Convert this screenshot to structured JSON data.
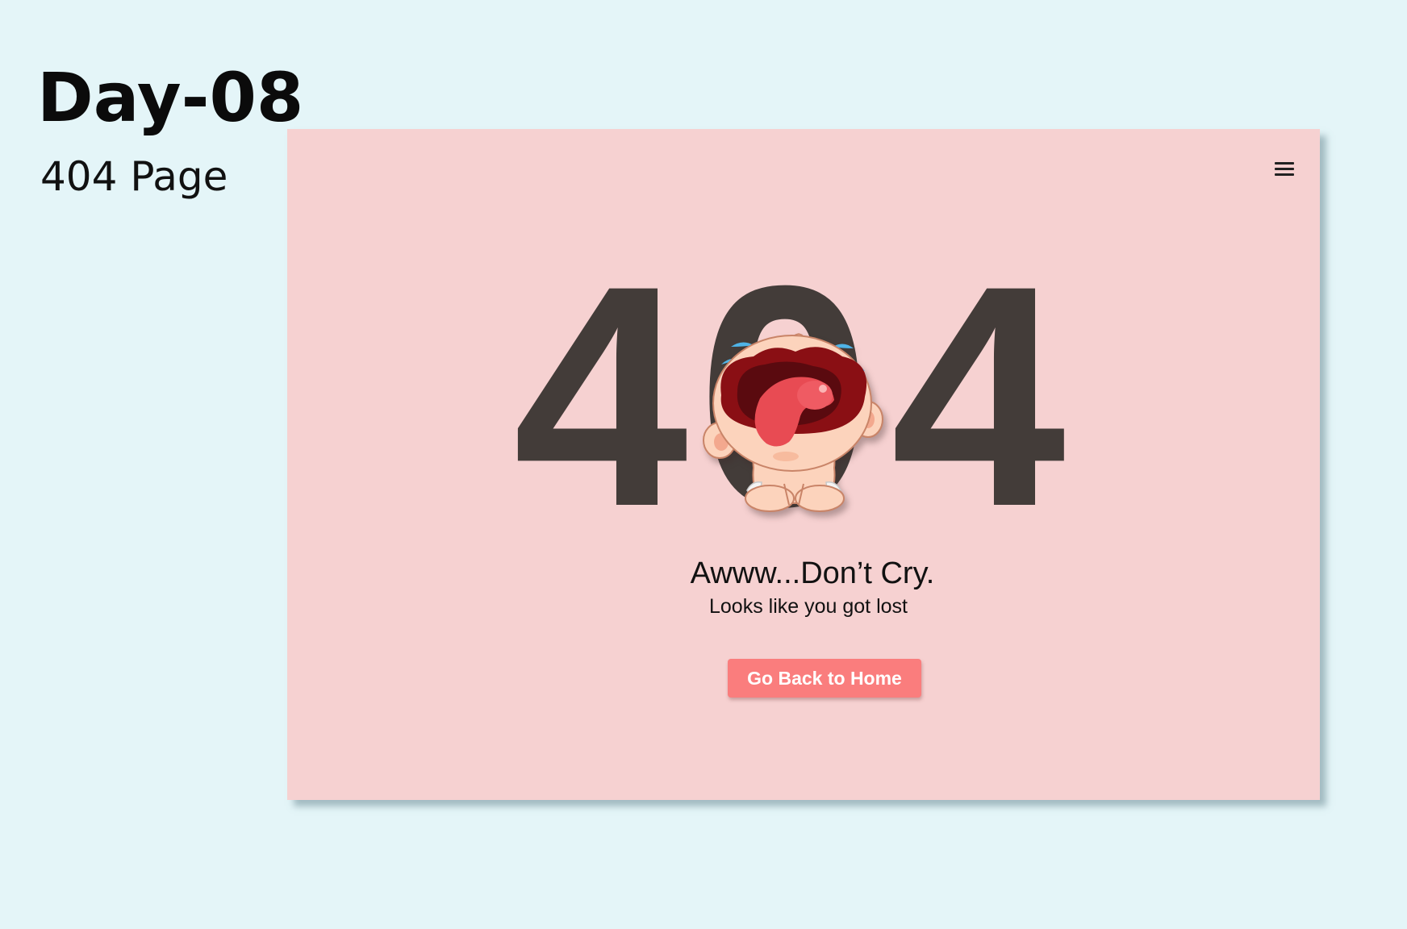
{
  "page": {
    "heading": "Day-08",
    "subheading": "404 Page"
  },
  "card": {
    "menu_icon": "hamburger-menu-icon",
    "hero_digits": [
      "4",
      "0",
      "4"
    ],
    "illustration": "crying-baby-icon",
    "title": "Awww...Don’t Cry.",
    "subtitle": "Looks like you got lost",
    "button_label": "Go Back to Home"
  },
  "colors": {
    "background": "#e4f5f8",
    "card": "#f6d1d1",
    "digits": "#433c39",
    "button": "#fa7d7d",
    "button_text": "#ffffff"
  }
}
